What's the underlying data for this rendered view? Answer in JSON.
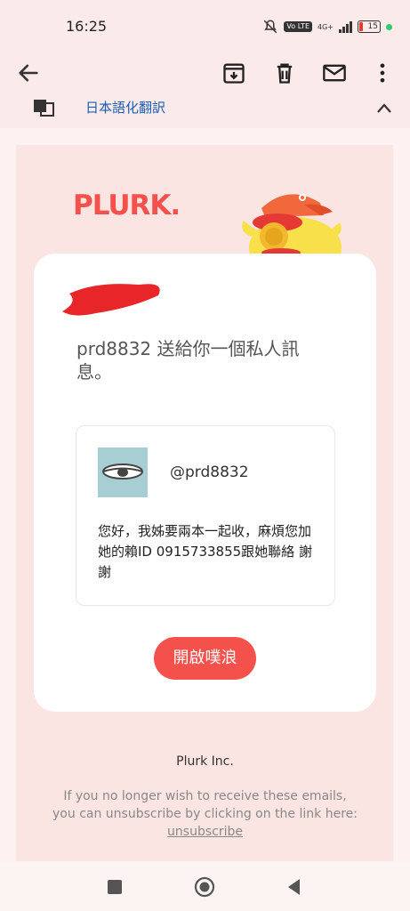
{
  "status_bar": {
    "time": "16:25",
    "network": "4G+",
    "volte": "Vo LTE",
    "battery": "15",
    "battery_color": "#e53935"
  },
  "toolbar": {
    "back_icon": "arrow-left-icon",
    "archive_icon": "archive-icon",
    "delete_icon": "trash-icon",
    "mail_icon": "mail-icon",
    "more_icon": "more-vert-icon"
  },
  "peek": {
    "text": "日本語化翻訳"
  },
  "email": {
    "brand": "PLURK.",
    "brand_color": "#f4514c",
    "intro": "prd8832 送給你一個私人訊息。",
    "sender_handle": "@prd8832",
    "message": "您好，我姊要兩本一起收，麻煩您加她的賴ID 0915733855跟她聯絡 謝謝",
    "open_button": "開啟噗浪",
    "footer_company": "Plurk Inc.",
    "footer_unsub_text": "If you no longer wish to receive these emails, you can unsubscribe by clicking on the link here:",
    "unsub_link": "unsubscribe"
  },
  "colors": {
    "background": "#fdf2f1",
    "accent": "#f4514c"
  }
}
